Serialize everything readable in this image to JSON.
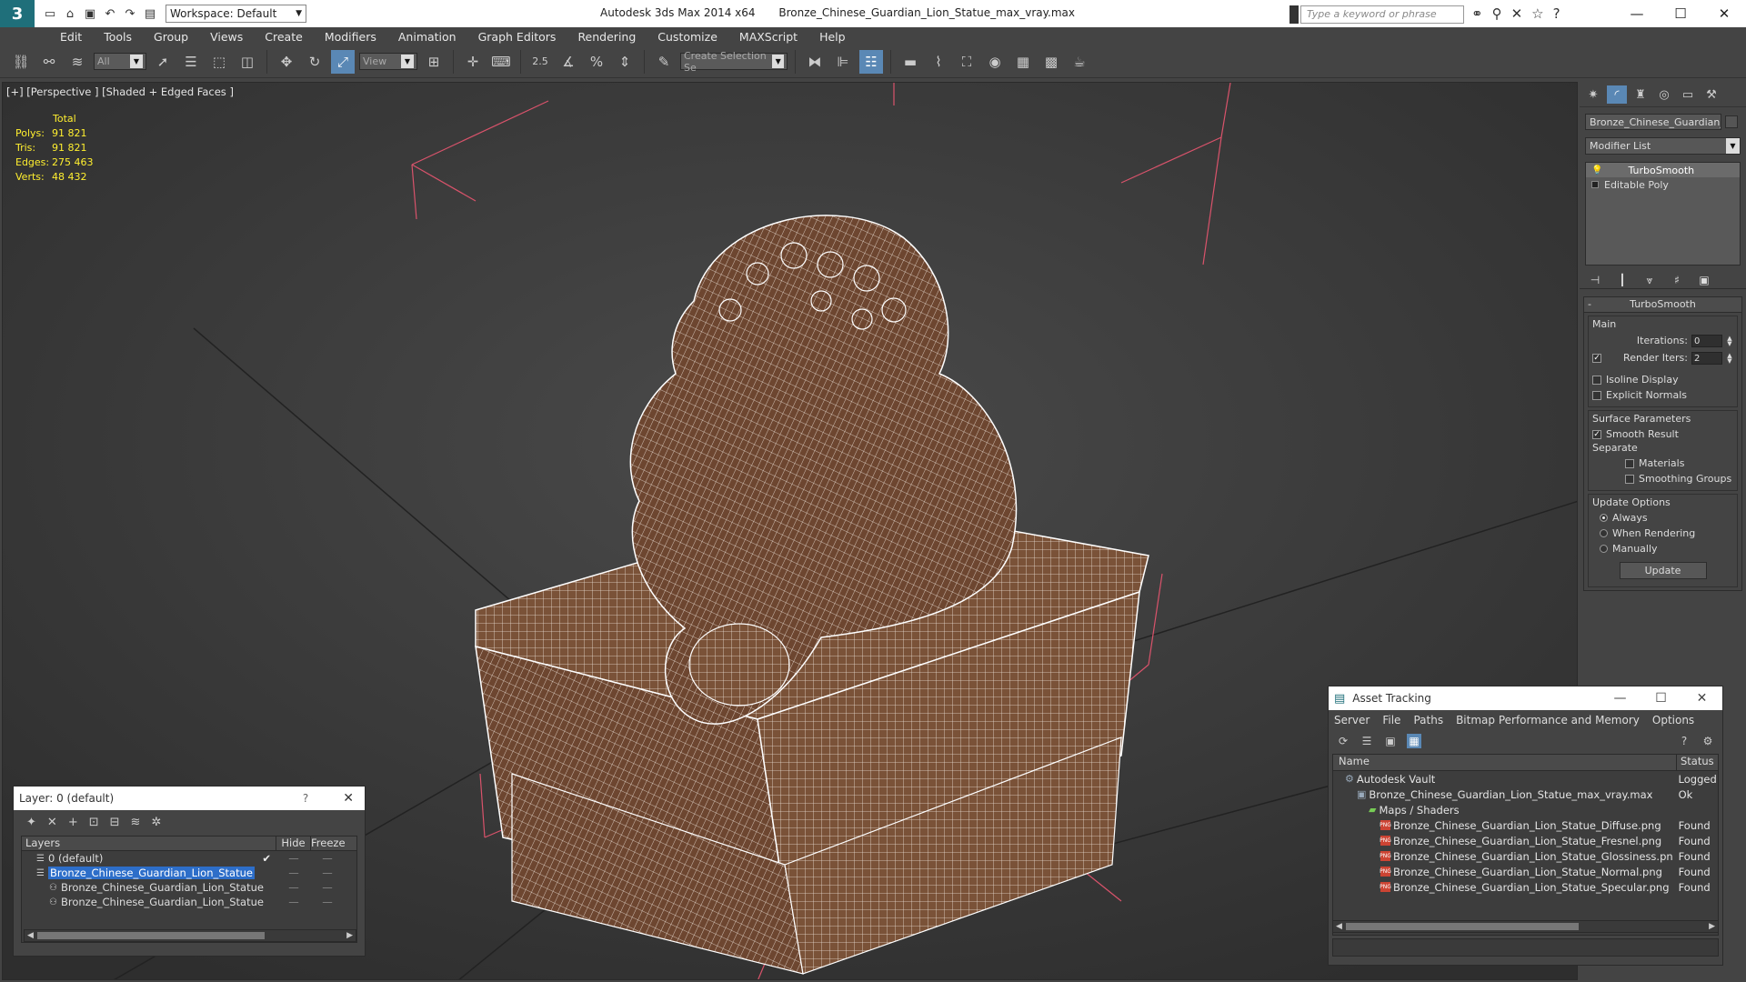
{
  "app": {
    "title": "Autodesk 3ds Max  2014 x64",
    "file": "Bronze_Chinese_Guardian_Lion_Statue_max_vray.max",
    "workspace": "Workspace: Default",
    "search_placeholder": "Type a keyword or phrase"
  },
  "menu": [
    "Edit",
    "Tools",
    "Group",
    "Views",
    "Create",
    "Modifiers",
    "Animation",
    "Graph Editors",
    "Rendering",
    "Customize",
    "MAXScript",
    "Help"
  ],
  "toolbar": {
    "filter": "All",
    "view": "View",
    "selection_set": "Create Selection Se",
    "snap_label": "2.5"
  },
  "viewport": {
    "label": "[+] [Perspective ] [Shaded + Edged Faces ]",
    "stats_header": "Total",
    "stats": [
      {
        "k": "Polys:",
        "v": "91 821"
      },
      {
        "k": "Tris:",
        "v": "91 821"
      },
      {
        "k": "Edges:",
        "v": "275 463"
      },
      {
        "k": "Verts:",
        "v": "48 432"
      }
    ]
  },
  "command_panel": {
    "object_name": "Bronze_Chinese_Guardian_Li",
    "modifier_list": "Modifier List",
    "stack": [
      "TurboSmooth",
      "Editable Poly"
    ],
    "rollout_title": "TurboSmooth",
    "main_label": "Main",
    "iterations_label": "Iterations:",
    "iterations_value": "0",
    "render_iters_label": "Render Iters:",
    "render_iters_value": "2",
    "isoline": "Isoline Display",
    "explicit": "Explicit Normals",
    "surface_label": "Surface Parameters",
    "smooth_result": "Smooth Result",
    "separate_label": "Separate",
    "materials": "Materials",
    "smoothing_groups": "Smoothing Groups",
    "update_label": "Update Options",
    "always": "Always",
    "when_rendering": "When Rendering",
    "manually": "Manually",
    "update_button": "Update"
  },
  "asset_tracking": {
    "title": "Asset Tracking",
    "menu": [
      "Server",
      "File",
      "Paths",
      "Bitmap Performance and Memory",
      "Options"
    ],
    "col_name": "Name",
    "col_status": "Status",
    "rows": [
      {
        "name": "Autodesk Vault",
        "status": "Logged C",
        "indent": 1,
        "icon": "vault-icon"
      },
      {
        "name": "Bronze_Chinese_Guardian_Lion_Statue_max_vray.max",
        "status": "Ok",
        "indent": 2,
        "icon": "max-file-icon"
      },
      {
        "name": "Maps / Shaders",
        "status": "",
        "indent": 3,
        "icon": "maps-icon"
      },
      {
        "name": "Bronze_Chinese_Guardian_Lion_Statue_Diffuse.png",
        "status": "Found",
        "indent": 4,
        "icon": "png-icon"
      },
      {
        "name": "Bronze_Chinese_Guardian_Lion_Statue_Fresnel.png",
        "status": "Found",
        "indent": 4,
        "icon": "png-icon"
      },
      {
        "name": "Bronze_Chinese_Guardian_Lion_Statue_Glossiness.png",
        "status": "Found",
        "indent": 4,
        "icon": "png-icon"
      },
      {
        "name": "Bronze_Chinese_Guardian_Lion_Statue_Normal.png",
        "status": "Found",
        "indent": 4,
        "icon": "png-icon"
      },
      {
        "name": "Bronze_Chinese_Guardian_Lion_Statue_Specular.png",
        "status": "Found",
        "indent": 4,
        "icon": "png-icon"
      }
    ]
  },
  "layer_manager": {
    "title": "Layer: 0 (default)",
    "help": "?",
    "col_layers": "Layers",
    "col_hide": "Hide",
    "col_freeze": "Freeze",
    "rows": [
      {
        "name": "0 (default)",
        "hide": "—",
        "freeze": "—",
        "indent": 1,
        "checked": "✔"
      },
      {
        "name": "Bronze_Chinese_Guardian_Lion_Statue",
        "hide": "—",
        "freeze": "—",
        "indent": 1,
        "checked": ""
      },
      {
        "name": "Bronze_Chinese_Guardian_Lion_Statue",
        "hide": "—",
        "freeze": "—",
        "indent": 2,
        "checked": ""
      },
      {
        "name": "Bronze_Chinese_Guardian_Lion_Statue",
        "hide": "—",
        "freeze": "—",
        "indent": 2,
        "checked": ""
      }
    ]
  },
  "colors": {
    "accent": "#5a88b5",
    "stats": "#ffef2f",
    "selection": "#2d6ec9",
    "gizmo": "#d9536b",
    "bronze": "#7a5238"
  }
}
